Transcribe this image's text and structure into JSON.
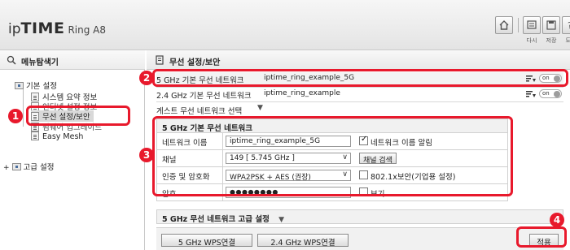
{
  "header": {
    "logo_ip": "ip",
    "logo_time": "TIME",
    "logo_model": "Ring A8",
    "icons": [
      {
        "name": "home-icon",
        "label": ""
      },
      {
        "name": "restart-icon",
        "label": "다시"
      },
      {
        "name": "save-icon",
        "label": "저장"
      },
      {
        "name": "help-icon",
        "label": "도움"
      }
    ]
  },
  "sidebar": {
    "title": "메뉴탐색기",
    "basic": "기본 설정",
    "basic_items": [
      "시스템 요약 정보",
      "인터넷 설정 정보",
      "무선 설정/보안",
      "펌웨어 업그레이드",
      "Easy Mesh"
    ],
    "advanced": "고급 설정"
  },
  "main": {
    "title": "무선 설정/보안",
    "net5_label": "5 GHz 기본 무선 네트워크",
    "net5_ssid": "iptime_ring_example_5G",
    "net24_label": "2.4 GHz 기본 무선 네트워크",
    "net24_ssid": "iptime_ring_example",
    "toggle_on": "on",
    "guest_label": "게스트 무선 네트워크 선택",
    "form": {
      "title": "5 GHz 기본 무선 네트워크",
      "name_label": "네트워크 이름",
      "name_value": "iptime_ring_example_5G",
      "hide_label": "네트워크 이름 알림",
      "channel_label": "채널",
      "channel_value": "149 [ 5.745 GHz ]",
      "channel_search": "채널 검색",
      "auth_label": "인증 및 암호화",
      "auth_value": "WPA2PSK + AES (권장)",
      "enterprise_label": "802.1x보안(기업용 설정)",
      "password_label": "암호",
      "password_value": "●●●●●●●●",
      "show_label": "보기"
    },
    "advanced_label": "5 GHz 무선 네트워크 고급 설정",
    "wps5": "5 GHz WPS연결",
    "wps24": "2.4 GHz WPS연결",
    "apply": "적용"
  },
  "annotations": [
    "1",
    "2",
    "3",
    "4"
  ],
  "colors": {
    "annotation": "#e8192c"
  }
}
